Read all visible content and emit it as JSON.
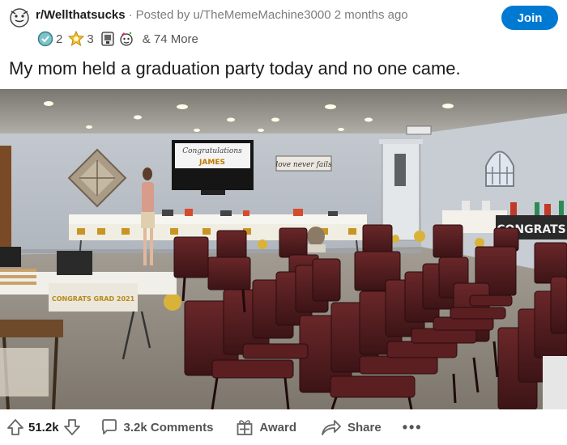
{
  "post": {
    "subreddit": "r/Wellthatsucks",
    "separator": "·",
    "posted_by": "Posted by u/TheMemeMachine3000 2 months ago",
    "join_label": "Join",
    "awards": [
      {
        "icon": "helpful-award-icon",
        "count": "2"
      },
      {
        "icon": "wholesome-award-icon",
        "count": "3"
      },
      {
        "icon": "facepalm-award-icon",
        "count": ""
      },
      {
        "icon": "party-award-icon",
        "count": ""
      }
    ],
    "more_awards": "& 74 More",
    "title": "My mom held a graduation party today and no one came."
  },
  "photo": {
    "tv_text_line1": "Congratulations",
    "tv_text_line2": "JAMES",
    "wall_sign": "love never fails",
    "table_banner": "CONGRATS GRAD 2021",
    "right_banner": "CONGRATS"
  },
  "actions": {
    "votes": "51.2k",
    "comments_label": "3.2k Comments",
    "award_label": "Award",
    "share_label": "Share",
    "more_label": "•••"
  },
  "colors": {
    "accent": "#0079d3",
    "chair": "#5a1f22",
    "wall": "#c9cdd2",
    "floor": "#8a857d"
  }
}
